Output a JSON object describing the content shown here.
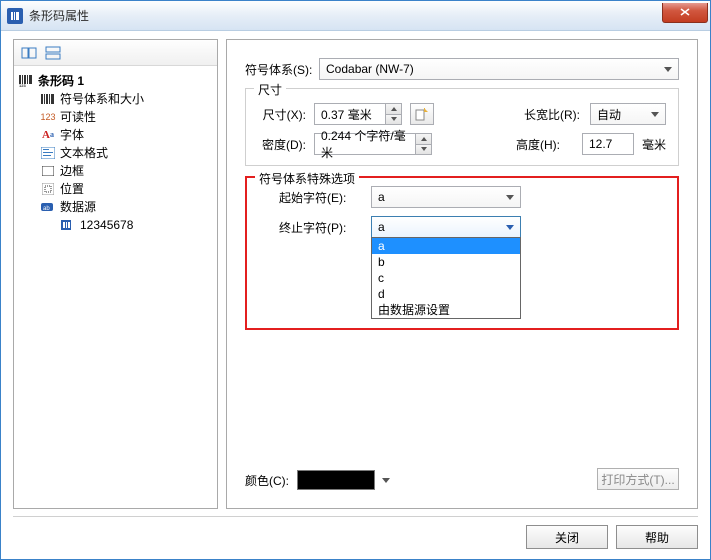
{
  "window": {
    "title": "条形码属性"
  },
  "tree": {
    "root": "条形码 1",
    "items": [
      {
        "label": "符号体系和大小"
      },
      {
        "label": "可读性",
        "prefix": "123"
      },
      {
        "label": "字体"
      },
      {
        "label": "文本格式"
      },
      {
        "label": "边框"
      },
      {
        "label": "位置"
      },
      {
        "label": "数据源"
      }
    ],
    "datasource_value": "12345678"
  },
  "main": {
    "symbology_label": "符号体系(S):",
    "symbology_value": "Codabar (NW-7)",
    "size_legend": "尺寸",
    "size_label": "尺寸(X):",
    "size_value": "0.37 毫米",
    "density_label": "密度(D):",
    "density_value": "0.244 个字符/毫米",
    "ratio_label": "长宽比(R):",
    "ratio_value": "自动",
    "height_label": "高度(H):",
    "height_value": "12.7",
    "height_unit": "毫米",
    "special_legend": "符号体系特殊选项",
    "start_label": "起始字符(E):",
    "start_value": "a",
    "stop_label": "终止字符(P):",
    "stop_value": "a",
    "stop_options": [
      "a",
      "b",
      "c",
      "d",
      "由数据源设置"
    ],
    "color_label": "颜色(C):",
    "print_label": "打印方式(T)..."
  },
  "footer": {
    "close": "关闭",
    "help": "帮助"
  }
}
